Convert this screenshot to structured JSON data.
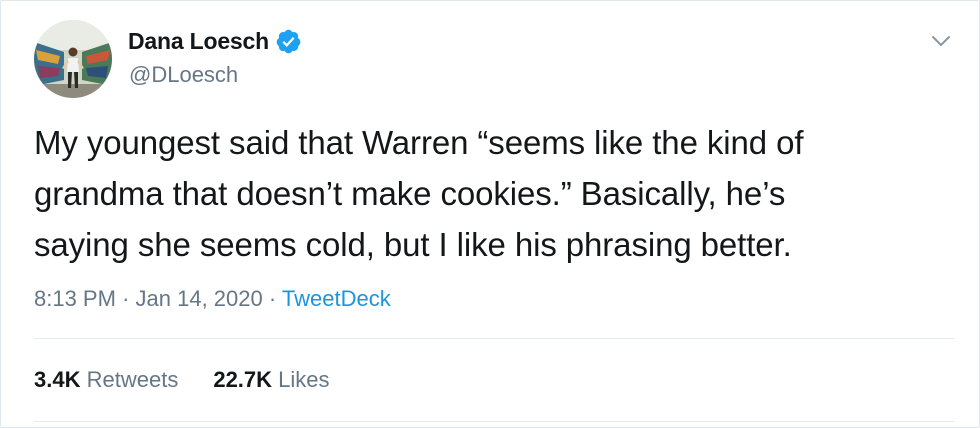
{
  "user": {
    "display_name": "Dana Loesch",
    "handle": "@DLoesch",
    "verified": true
  },
  "tweet": {
    "text_lines": [
      "My youngest said that Warren “seems like the kind of",
      "grandma that doesn’t make cookies.” Basically, he’s",
      "saying she seems cold, but I like his phrasing better."
    ],
    "time": "8:13 PM",
    "date": "Jan 14, 2020",
    "separator": "·",
    "source": "TweetDeck"
  },
  "stats": {
    "retweets_count": "3.4K",
    "retweets_label": "Retweets",
    "likes_count": "22.7K",
    "likes_label": "Likes"
  },
  "icons": {
    "verified": "verified-badge-icon",
    "menu": "chevron-down-icon"
  },
  "colors": {
    "text": "#14171a",
    "secondary": "#657786",
    "link": "#1b95e0",
    "verified": "#1da1f2",
    "divider": "#e6ecf0"
  }
}
